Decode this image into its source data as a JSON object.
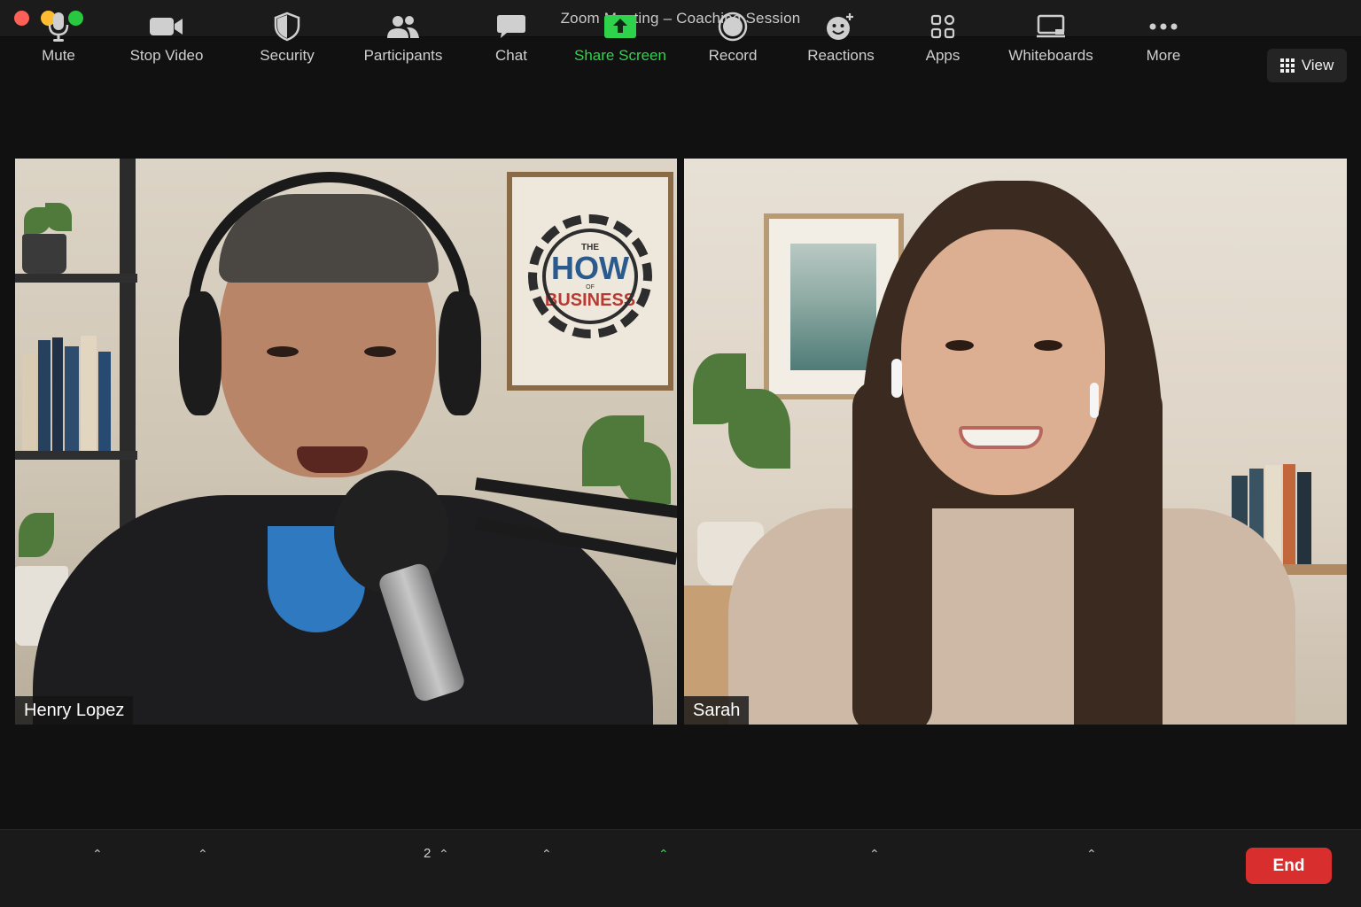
{
  "window": {
    "title": "Zoom Meeting – Coaching Session"
  },
  "view_button": {
    "label": "View",
    "icon": "grid-icon"
  },
  "participants_tiles": [
    {
      "name": "Henry Lopez"
    },
    {
      "name": "Sarah"
    }
  ],
  "poster": {
    "the": "THE",
    "how": "HOW",
    "of": "OF",
    "business": "BUSINESS"
  },
  "toolbar": {
    "mute": {
      "label": "Mute",
      "icon": "microphone-icon"
    },
    "stop_video": {
      "label": "Stop Video",
      "icon": "video-camera-icon"
    },
    "security": {
      "label": "Security",
      "icon": "shield-icon"
    },
    "participants": {
      "label": "Participants",
      "count": "2",
      "icon": "people-icon"
    },
    "chat": {
      "label": "Chat",
      "icon": "chat-bubble-icon"
    },
    "share_screen": {
      "label": "Share Screen",
      "icon": "share-arrow-icon",
      "color": "#2fd34b"
    },
    "record": {
      "label": "Record",
      "icon": "record-icon"
    },
    "reactions": {
      "label": "Reactions",
      "icon": "smiley-plus-icon"
    },
    "apps": {
      "label": "Apps",
      "icon": "apps-icon"
    },
    "whiteboards": {
      "label": "Whiteboards",
      "icon": "whiteboard-icon"
    },
    "more": {
      "label": "More",
      "icon": "ellipsis-icon"
    },
    "end": {
      "label": "End",
      "color": "#d82e2e"
    }
  }
}
